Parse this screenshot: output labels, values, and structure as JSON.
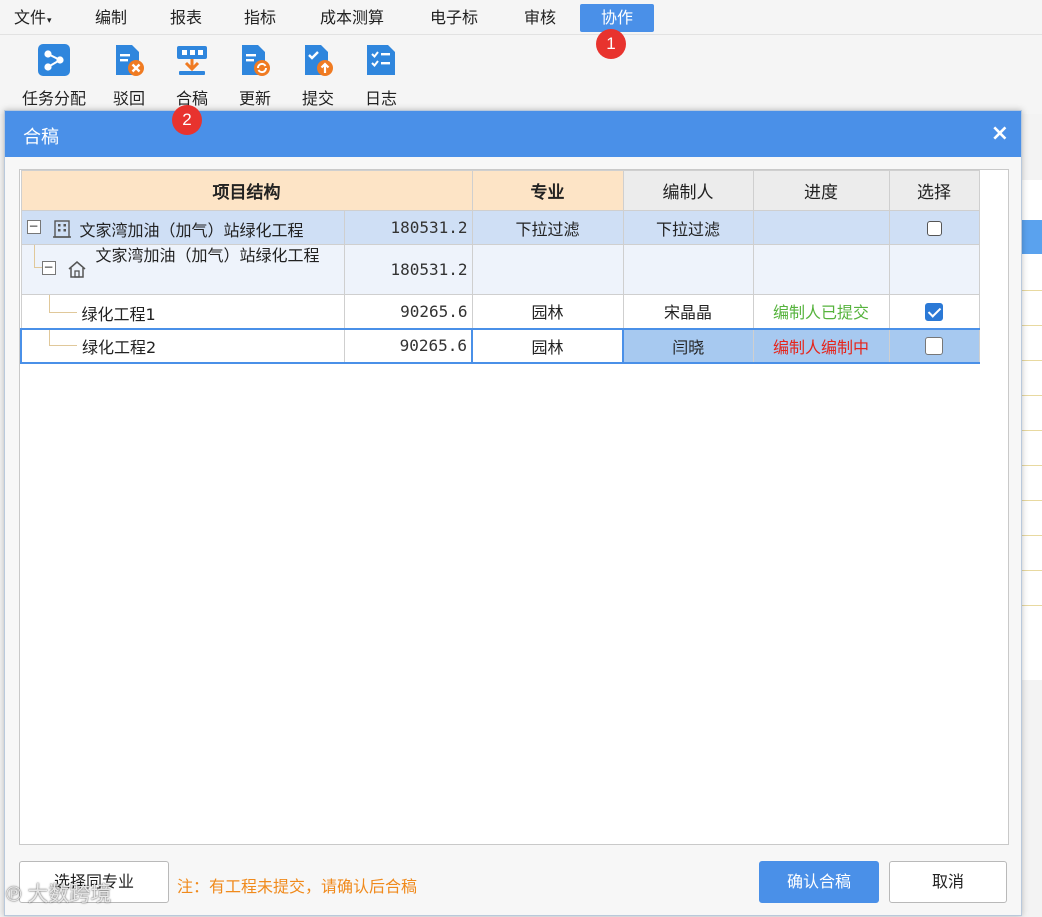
{
  "menubar": {
    "items": [
      {
        "label": "文件"
      },
      {
        "label": "编制"
      },
      {
        "label": "报表"
      },
      {
        "label": "指标"
      },
      {
        "label": "成本测算"
      },
      {
        "label": "电子标"
      },
      {
        "label": "审核"
      },
      {
        "label": "协作",
        "active": true
      }
    ],
    "file_caret": "▾"
  },
  "badges": [
    "1",
    "2"
  ],
  "ribbon": {
    "tools": [
      {
        "label": "任务分配",
        "icon": "task-assign-icon"
      },
      {
        "label": "驳回",
        "icon": "reject-icon"
      },
      {
        "label": "合稿",
        "icon": "merge-draft-icon"
      },
      {
        "label": "更新",
        "icon": "update-icon"
      },
      {
        "label": "提交",
        "icon": "submit-icon"
      },
      {
        "label": "日志",
        "icon": "log-icon"
      }
    ]
  },
  "dialog": {
    "title": "合稿",
    "close": "×",
    "columns": [
      "项目结构",
      "专业",
      "编制人",
      "进度",
      "选择"
    ],
    "rows": [
      {
        "name": "文家湾加油（加气）站绿化工程",
        "amount": "180531.2",
        "major": "下拉过滤",
        "editor": "下拉过滤",
        "progress": "",
        "icon": "building-icon"
      },
      {
        "name": "文家湾加油（加气）站绿化工程",
        "amount": "180531.2",
        "major": "",
        "editor": "",
        "progress": "",
        "icon": "home-icon"
      },
      {
        "name": "绿化工程1",
        "amount": "90265.6",
        "major": "园林",
        "editor": "宋晶晶",
        "progress": "编制人已提交",
        "checked": true
      },
      {
        "name": "绿化工程2",
        "amount": "90265.6",
        "major": "园林",
        "editor": "闫晓",
        "progress": "编制人编制中",
        "checked": false
      }
    ],
    "tree_toggle": "−",
    "footer": {
      "select_same_major": "选择同专业",
      "note": "注：有工程未提交，请确认后合稿",
      "confirm": "确认合稿",
      "cancel": "取消"
    }
  },
  "colors": {
    "accent": "#4a90e8",
    "header_highlight": "#fde4c6",
    "submitted": "#56b33d",
    "in_progress": "#e5251c",
    "note": "#f08a1c",
    "badge": "#e8332e"
  },
  "watermark": "大数跨境"
}
